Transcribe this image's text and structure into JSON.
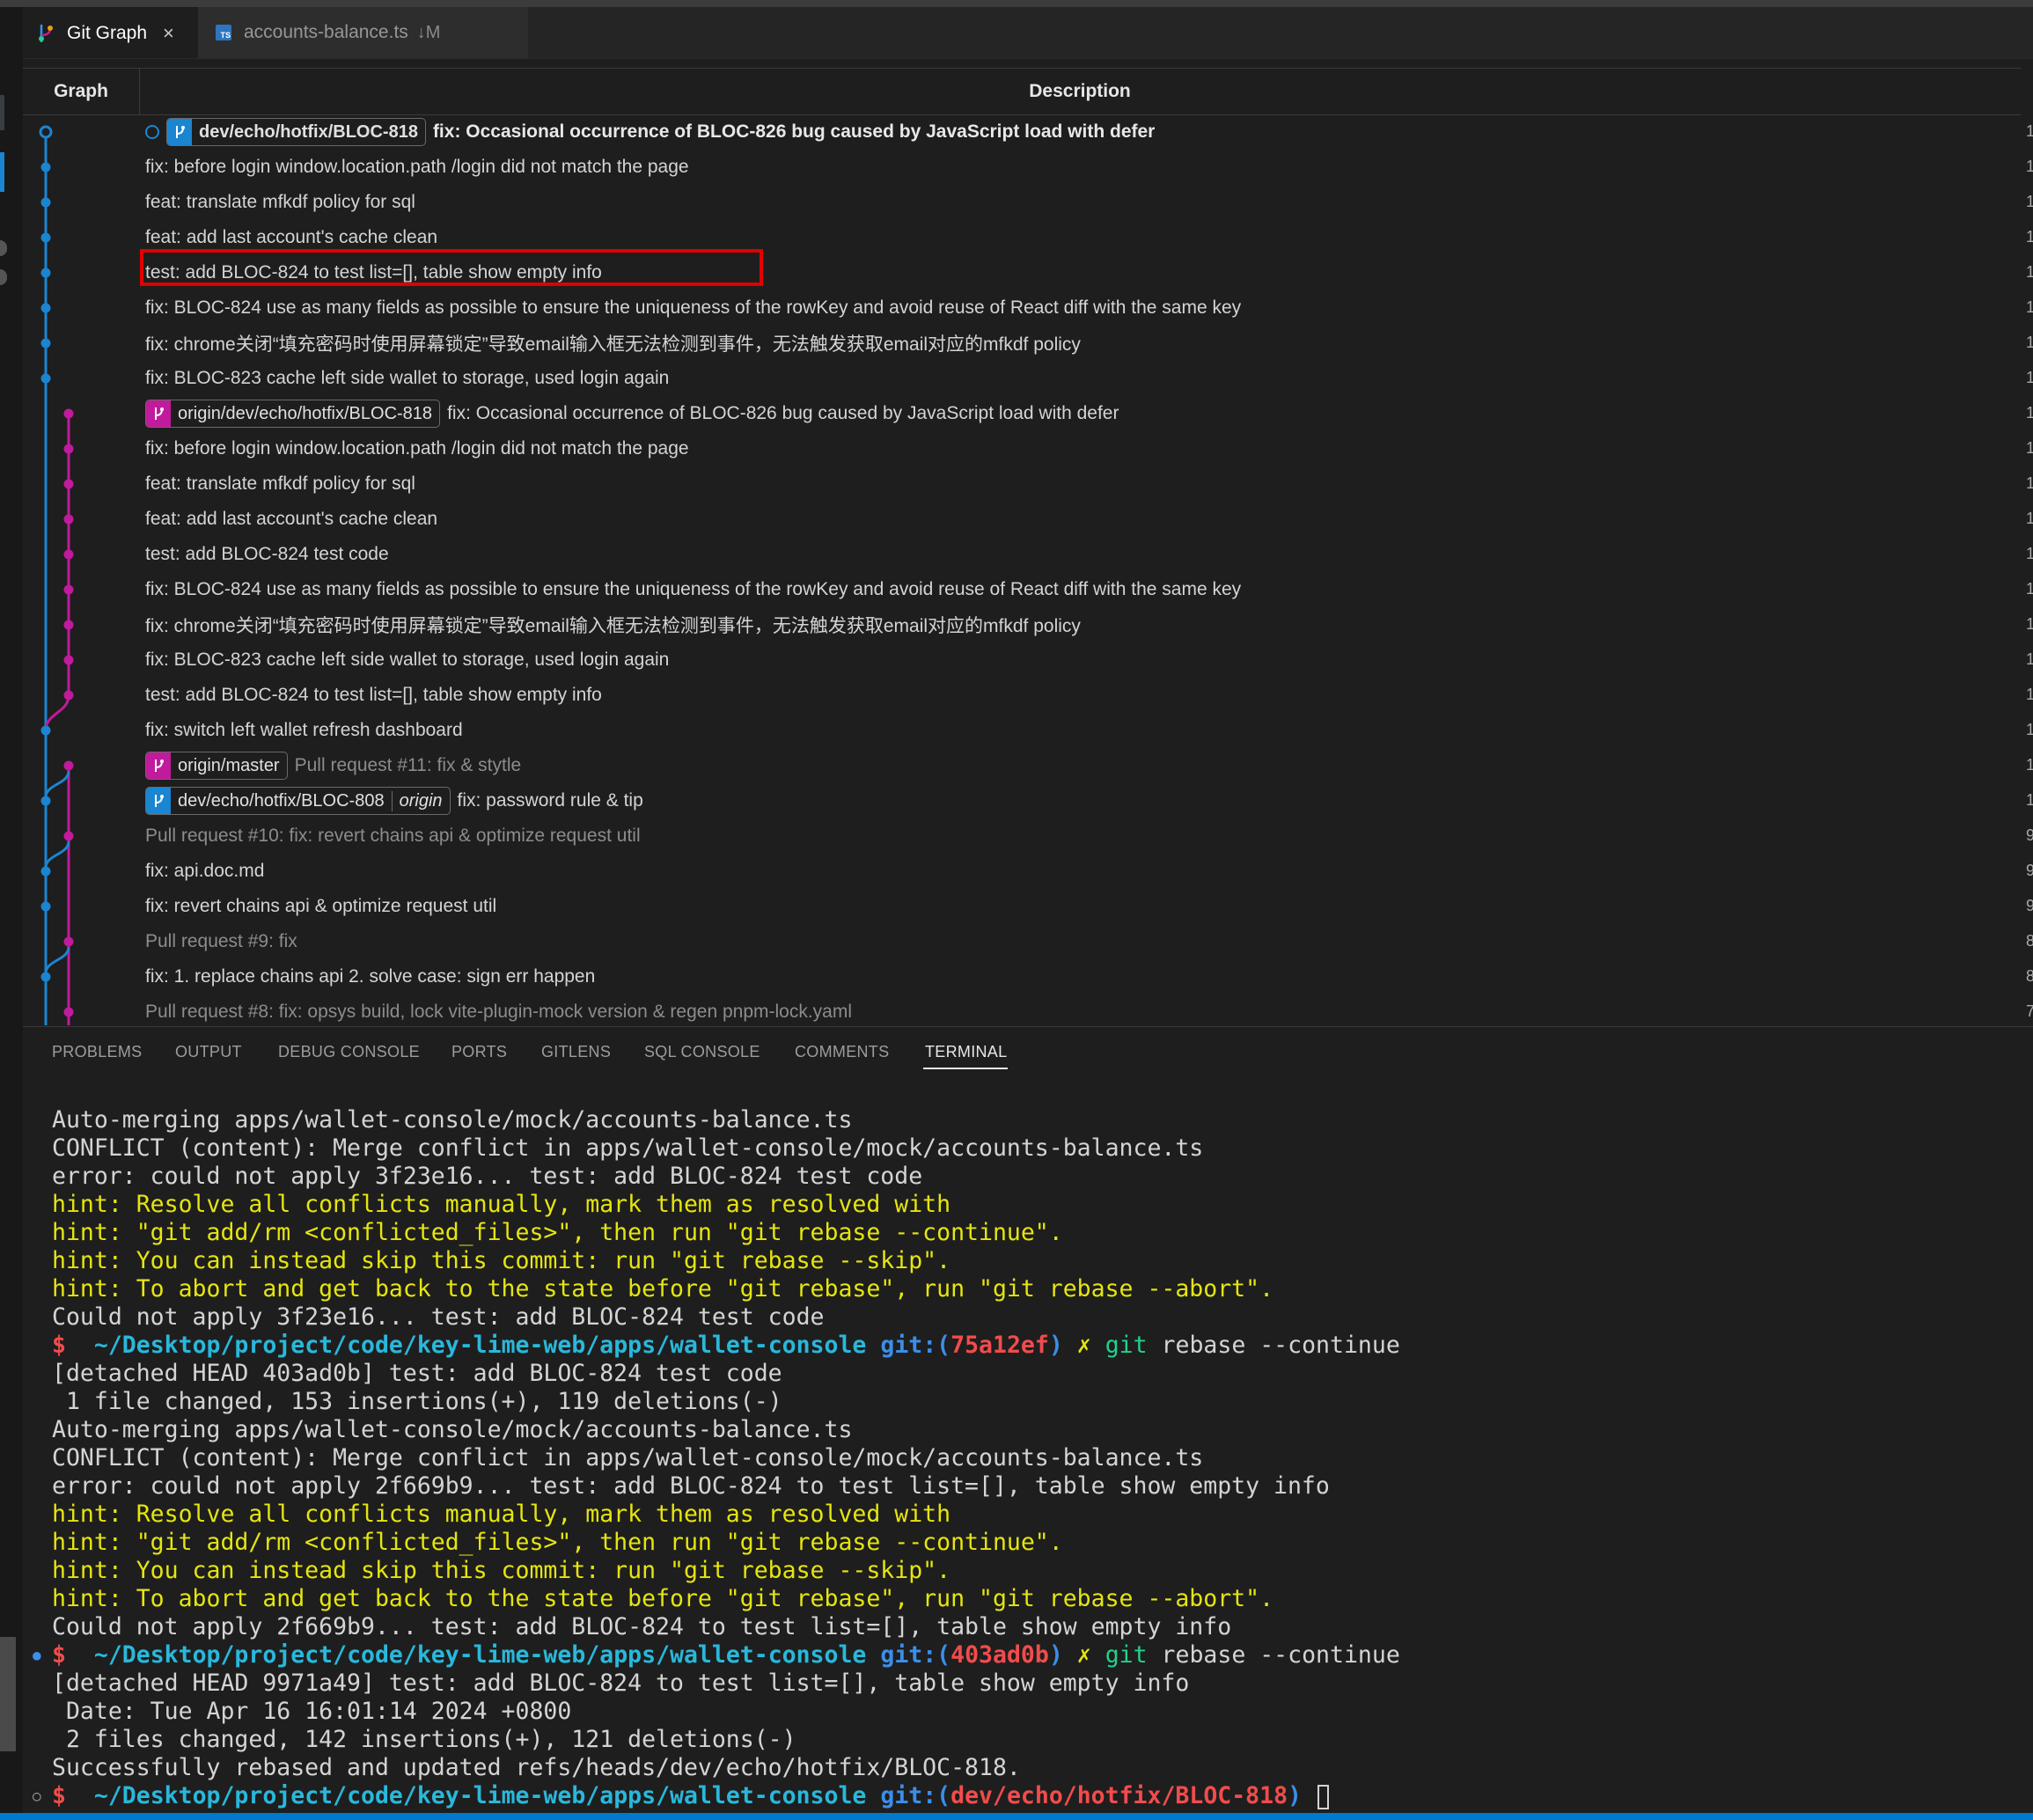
{
  "tabs": [
    {
      "label": "Git Graph",
      "close": "×"
    },
    {
      "label": "accounts-balance.ts",
      "badge": "TS",
      "modifier": "↓M"
    }
  ],
  "graph": {
    "columns": {
      "graph": "Graph",
      "description": "Description"
    },
    "head_ref": "dev/echo/hotfix/BLOC-818",
    "rows": [
      {
        "refs": [
          {
            "name": "dev/echo/hotfix/BLOC-818",
            "color": "blue",
            "bold": true
          }
        ],
        "message": "fix: Occasional occurrence of BLOC-826 bug caused by JavaScript load with defer",
        "style": "bold",
        "lane": 0,
        "head": true
      },
      {
        "message": "fix: before login window.location.path /login did not match the page",
        "lane": 0
      },
      {
        "message": "feat: translate mfkdf policy for sql",
        "lane": 0
      },
      {
        "message": "feat: add last account's cache clean",
        "lane": 0
      },
      {
        "message": "test: add BLOC-824 to test list=[], table show empty info",
        "lane": 0,
        "highlighted": true
      },
      {
        "message": "fix: BLOC-824 use as many fields as possible to ensure the uniqueness of the rowKey and avoid reuse of React diff with the same key",
        "lane": 0
      },
      {
        "message": "fix: chrome关闭“填充密码时使用屏幕锁定”导致email输入框无法检测到事件，无法触发获取email对应的mfkdf policy",
        "lane": 0
      },
      {
        "message": "fix: BLOC-823 cache left side wallet to storage, used login again",
        "lane": 0
      },
      {
        "refs": [
          {
            "name": "origin/dev/echo/hotfix/BLOC-818",
            "color": "pink"
          }
        ],
        "message": "fix: Occasional occurrence of BLOC-826 bug caused by JavaScript load with defer",
        "lane": 1
      },
      {
        "message": "fix: before login window.location.path /login did not match the page",
        "lane": 1
      },
      {
        "message": "feat: translate mfkdf policy for sql",
        "lane": 1
      },
      {
        "message": "feat: add last account's cache clean",
        "lane": 1
      },
      {
        "message": "test: add BLOC-824 test code",
        "lane": 1
      },
      {
        "message": "fix: BLOC-824 use as many fields as possible to ensure the uniqueness of the rowKey and avoid reuse of React diff with the same key",
        "lane": 1
      },
      {
        "message": "fix: chrome关闭“填充密码时使用屏幕锁定”导致email输入框无法检测到事件，无法触发获取email对应的mfkdf policy",
        "lane": 1
      },
      {
        "message": "fix: BLOC-823 cache left side wallet to storage, used login again",
        "lane": 1
      },
      {
        "message": "test: add BLOC-824 to test list=[], table show empty info",
        "lane": 1
      },
      {
        "message": "fix: switch left wallet refresh dashboard",
        "lane": 0
      },
      {
        "refs": [
          {
            "name": "origin/master",
            "color": "pink"
          }
        ],
        "message": "Pull request #11: fix & stytle",
        "style": "dim",
        "lane": 1
      },
      {
        "refs": [
          {
            "name": "dev/echo/hotfix/BLOC-808",
            "color": "blue",
            "remote": "origin"
          }
        ],
        "message": "fix: password rule & tip",
        "lane": 0
      },
      {
        "message": "Pull request #10: fix: revert chains api & optimize request util",
        "style": "dim",
        "lane": 1
      },
      {
        "message": "fix: api.doc.md",
        "lane": 0
      },
      {
        "message": "fix: revert chains api & optimize request util",
        "lane": 0
      },
      {
        "message": "Pull request #9: fix",
        "style": "dim",
        "lane": 1
      },
      {
        "message": "fix: 1. replace chains api 2. solve case: sign err happen",
        "lane": 0
      },
      {
        "message": "Pull request #8: fix: opsys build, lock vite-plugin-mock version & regen pnpm-lock.yaml",
        "style": "dim",
        "lane": 1
      }
    ],
    "right_edge_digits": [
      "1",
      "1",
      "1",
      "1",
      "1",
      "1",
      "1",
      "1",
      "1",
      "1",
      "1",
      "1",
      "1",
      "1",
      "1",
      "1",
      "1",
      "1",
      "1",
      "1",
      "9",
      "9",
      "9",
      "8",
      "8",
      "7"
    ]
  },
  "panel": {
    "tabs": [
      "PROBLEMS",
      "OUTPUT",
      "DEBUG CONSOLE",
      "PORTS",
      "GITLENS",
      "SQL CONSOLE",
      "COMMENTS",
      "TERMINAL"
    ],
    "active_tab": "TERMINAL"
  },
  "terminal": {
    "lines": [
      {
        "type": "plain",
        "text": "Auto-merging apps/wallet-console/mock/accounts-balance.ts"
      },
      {
        "type": "plain",
        "text": "CONFLICT (content): Merge conflict in apps/wallet-console/mock/accounts-balance.ts"
      },
      {
        "type": "plain",
        "text": "error: could not apply 3f23e16... test: add BLOC-824 test code"
      },
      {
        "type": "hint",
        "text": "hint: Resolve all conflicts manually, mark them as resolved with"
      },
      {
        "type": "hint",
        "text": "hint: \"git add/rm <conflicted_files>\", then run \"git rebase --continue\"."
      },
      {
        "type": "hint",
        "text": "hint: You can instead skip this commit: run \"git rebase --skip\"."
      },
      {
        "type": "hint",
        "text": "hint: To abort and get back to the state before \"git rebase\", run \"git rebase --abort\"."
      },
      {
        "type": "plain",
        "text": "Could not apply 3f23e16... test: add BLOC-824 test code"
      },
      {
        "type": "prompt",
        "dollar": "$",
        "path": "~/Desktop/project/code/key-lime-web/apps/wallet-console",
        "git": "git:(",
        "branch": "75a12ef",
        "close": ")",
        "mark": "✗",
        "cmd": "git",
        "args": "rebase --continue"
      },
      {
        "type": "plain",
        "text": "[detached HEAD 403ad0b] test: add BLOC-824 test code"
      },
      {
        "type": "plain",
        "text": " 1 file changed, 153 insertions(+), 119 deletions(-)"
      },
      {
        "type": "plain",
        "text": "Auto-merging apps/wallet-console/mock/accounts-balance.ts"
      },
      {
        "type": "plain",
        "text": "CONFLICT (content): Merge conflict in apps/wallet-console/mock/accounts-balance.ts"
      },
      {
        "type": "plain",
        "text": "error: could not apply 2f669b9... test: add BLOC-824 to test list=[], table show empty info"
      },
      {
        "type": "hint",
        "text": "hint: Resolve all conflicts manually, mark them as resolved with"
      },
      {
        "type": "hint",
        "text": "hint: \"git add/rm <conflicted_files>\", then run \"git rebase --continue\"."
      },
      {
        "type": "hint",
        "text": "hint: You can instead skip this commit: run \"git rebase --skip\"."
      },
      {
        "type": "hint",
        "text": "hint: To abort and get back to the state before \"git rebase\", run \"git rebase --abort\"."
      },
      {
        "type": "plain",
        "text": "Could not apply 2f669b9... test: add BLOC-824 to test list=[], table show empty info"
      },
      {
        "type": "prompt",
        "gutter": "●",
        "dollar": "$",
        "path": "~/Desktop/project/code/key-lime-web/apps/wallet-console",
        "git": "git:(",
        "branch": "403ad0b",
        "close": ")",
        "mark": "✗",
        "cmd": "git",
        "args": "rebase --continue"
      },
      {
        "type": "plain",
        "text": "[detached HEAD 9971a49] test: add BLOC-824 to test list=[], table show empty info"
      },
      {
        "type": "plain",
        "text": " Date: Tue Apr 16 16:01:14 2024 +0800"
      },
      {
        "type": "plain",
        "text": " 2 files changed, 142 insertions(+), 121 deletions(-)"
      },
      {
        "type": "plain",
        "text": "Successfully rebased and updated refs/heads/dev/echo/hotfix/BLOC-818."
      },
      {
        "type": "prompt",
        "gutter": "○",
        "dollar": "$",
        "path": "~/Desktop/project/code/key-lime-web/apps/wallet-console",
        "git": "git:(",
        "branch": "dev/echo/hotfix/BLOC-818",
        "close": ")",
        "cursor": true
      }
    ]
  },
  "colors": {
    "lane0": "#1a85d1",
    "lane1": "#c11a9c",
    "highlight": "#e00000"
  }
}
